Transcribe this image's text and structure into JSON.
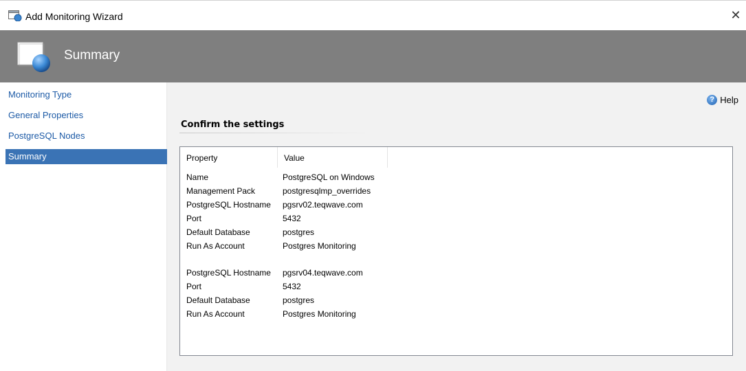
{
  "window": {
    "title": "Add Monitoring Wizard",
    "close_glyph": "✕",
    "icon": "wizard-window-icon"
  },
  "header": {
    "title": "Summary",
    "icon": "wizard-page-icon",
    "background": "#7f7f7f"
  },
  "sidebar": {
    "items": [
      {
        "label": "Monitoring Type",
        "active": false
      },
      {
        "label": "General Properties",
        "active": false
      },
      {
        "label": "PostgreSQL Nodes",
        "active": false
      },
      {
        "label": "Summary",
        "active": true
      }
    ],
    "active_color": "#3a73b5",
    "link_color": "#1c5aa6"
  },
  "main": {
    "help_label": "Help",
    "heading": "Confirm the settings",
    "columns": [
      "Property",
      "Value"
    ],
    "rows": [
      {
        "property": "Name",
        "value": "PostgreSQL on Windows"
      },
      {
        "property": "Management Pack",
        "value": "postgresqlmp_overrides"
      },
      {
        "property": "PostgreSQL Hostname",
        "value": "pgsrv02.teqwave.com"
      },
      {
        "property": "Port",
        "value": "5432"
      },
      {
        "property": "Default Database",
        "value": "postgres"
      },
      {
        "property": "Run As Account",
        "value": "Postgres Monitoring"
      },
      {
        "property": "",
        "value": ""
      },
      {
        "property": "PostgreSQL Hostname",
        "value": "pgsrv04.teqwave.com"
      },
      {
        "property": "Port",
        "value": "5432"
      },
      {
        "property": "Default Database",
        "value": "postgres"
      },
      {
        "property": "Run As Account",
        "value": "Postgres Monitoring"
      }
    ]
  }
}
